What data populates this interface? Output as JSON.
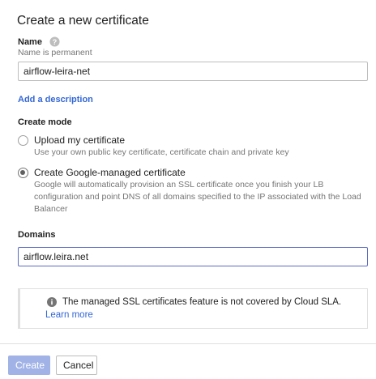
{
  "form": {
    "title": "Create a new certificate",
    "name_label": "Name",
    "name_hint": "Name is permanent",
    "name_value": "airflow-leira-net",
    "add_description": "Add a description",
    "create_mode_label": "Create mode",
    "modes": [
      {
        "title": "Upload my certificate",
        "description": "Use your own public key certificate, certificate chain and private key",
        "selected": false
      },
      {
        "title": "Create Google-managed certificate",
        "description": "Google will automatically provision an SSL certificate once you finish your LB configuration and point DNS of all domains specified to the IP associated with the Load Balancer",
        "selected": true
      }
    ],
    "domains_label": "Domains",
    "domains_value": "airflow.leira.net"
  },
  "info": {
    "icon": "info-icon",
    "text": "The managed SSL certificates feature is not covered by Cloud SLA.",
    "link": "Learn more"
  },
  "actions": {
    "create": "Create",
    "cancel": "Cancel"
  },
  "colors": {
    "accent": "#3367d6",
    "create_button_disabled": "#a1b3e6",
    "border": "#bdbdbd"
  }
}
